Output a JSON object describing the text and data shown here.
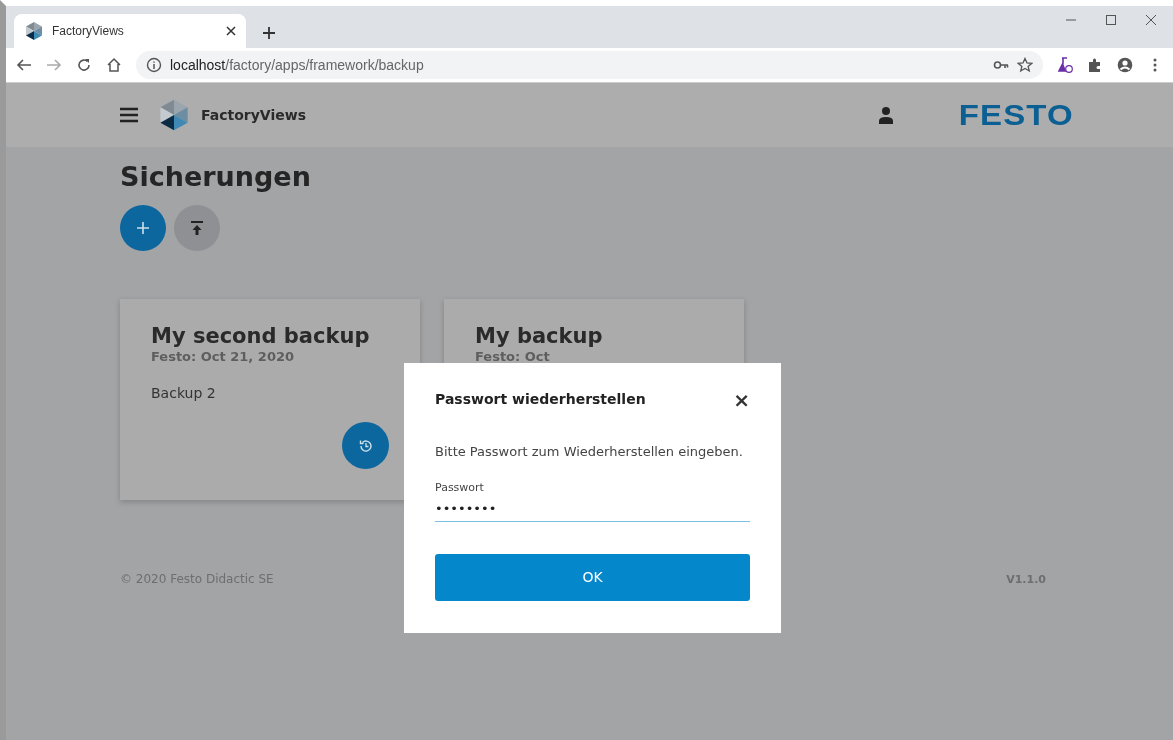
{
  "browser": {
    "tab_title": "FactoryViews",
    "url_host": "localhost",
    "url_path": "/factory/apps/framework/backup"
  },
  "header": {
    "app_name": "FactoryViews",
    "brand": "FESTO"
  },
  "page": {
    "title": "Sicherungen"
  },
  "backups": [
    {
      "title": "My second backup",
      "subtitle": "Festo: Oct 21, 2020",
      "description": "Backup 2"
    },
    {
      "title": "My backup",
      "subtitle": "Festo: Oct"
    }
  ],
  "footer": {
    "copyright": "© 2020 Festo Didactic SE",
    "version": "V1.1.0"
  },
  "dialog": {
    "title": "Passwort wiederherstellen",
    "close": "×",
    "message": "Bitte Passwort zum Wiederherstellen eingeben.",
    "field_label": "Passwort",
    "field_value": "••••••••",
    "button": "OK"
  }
}
